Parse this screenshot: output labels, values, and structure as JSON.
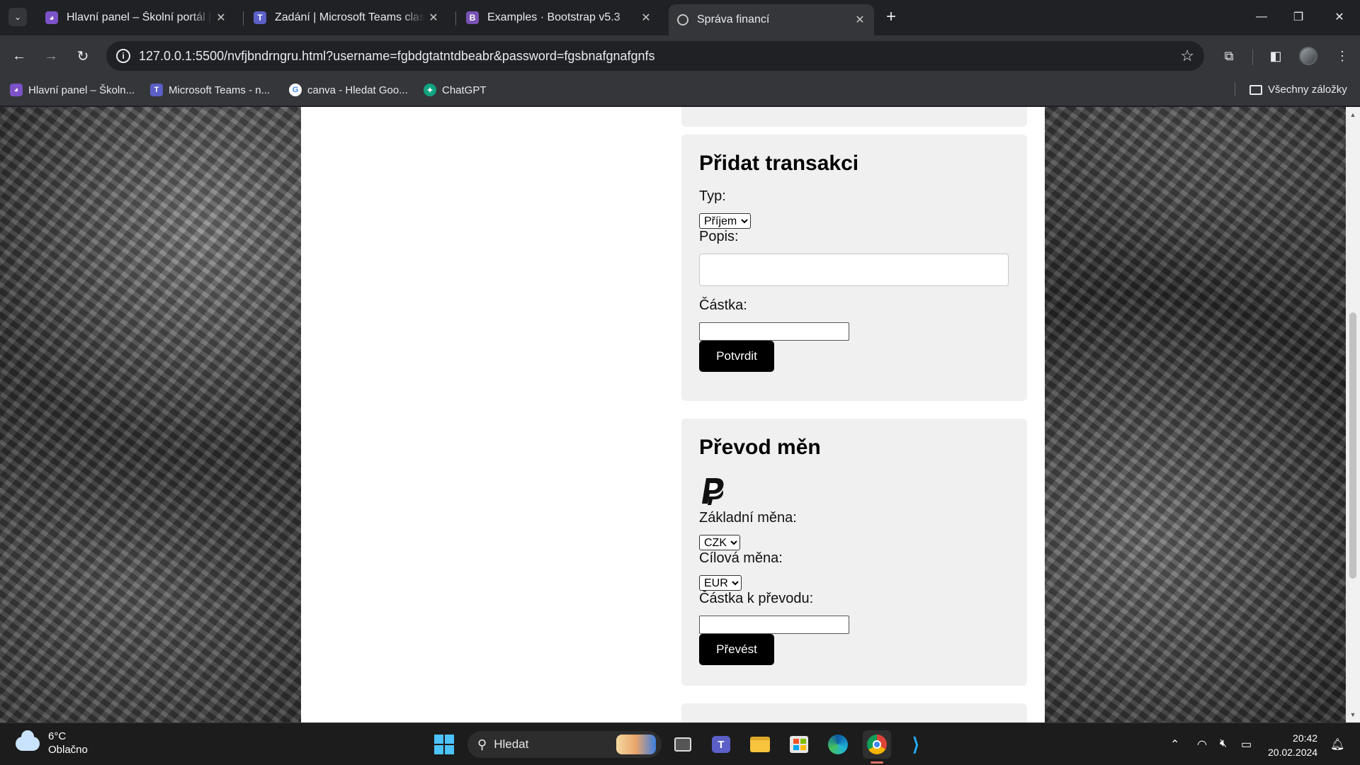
{
  "browser": {
    "tabs": [
      {
        "title": "Hlavní panel – Školní portál | htt",
        "favicon": "purple-mascot-icon",
        "active": false
      },
      {
        "title": "Zadání | Microsoft Teams classic",
        "favicon": "teams-icon",
        "active": false
      },
      {
        "title": "Examples · Bootstrap v5.3",
        "favicon": "bootstrap-icon",
        "active": false
      },
      {
        "title": "Správa financí",
        "favicon": "globe-icon",
        "active": true
      }
    ],
    "url": "127.0.0.1:5500/nvfjbndrngru.html?username=fgbdgtatntdbeabr&password=fgsbnafgnafgnfs",
    "bookmarks": [
      {
        "label": "Hlavní panel – Školn...",
        "icon": "purple-mascot-icon"
      },
      {
        "label": "Microsoft Teams - n...",
        "icon": "teams-icon"
      },
      {
        "label": "canva - Hledat Goo...",
        "icon": "google-icon"
      },
      {
        "label": "ChatGPT",
        "icon": "chatgpt-icon"
      }
    ],
    "all_bookmarks_label": "Všechny záložky",
    "bootstrap_letter": "B"
  },
  "page": {
    "add_transaction": {
      "title": "Přidat transakci",
      "type_label": "Typ:",
      "type_value": "Příjem",
      "description_label": "Popis:",
      "description_value": "",
      "amount_label": "Částka:",
      "amount_value": "",
      "submit_label": "Potvrdit"
    },
    "currency_conversion": {
      "title": "Převod měn",
      "icon": "paypal-icon",
      "base_label": "Základní měna:",
      "base_value": "CZK",
      "target_label": "Cílová měna:",
      "target_value": "EUR",
      "amount_label": "Částka k převodu:",
      "amount_value": "",
      "submit_label": "Převést"
    }
  },
  "taskbar": {
    "weather_temp": "6°C",
    "weather_desc": "Oblačno",
    "search_placeholder": "Hledat",
    "time": "20:42",
    "date": "20.02.2024"
  },
  "colors": {
    "button_bg": "#000000",
    "card_bg": "#f0f0f0",
    "browser_dark": "#202124",
    "toolbar": "#35363a"
  }
}
